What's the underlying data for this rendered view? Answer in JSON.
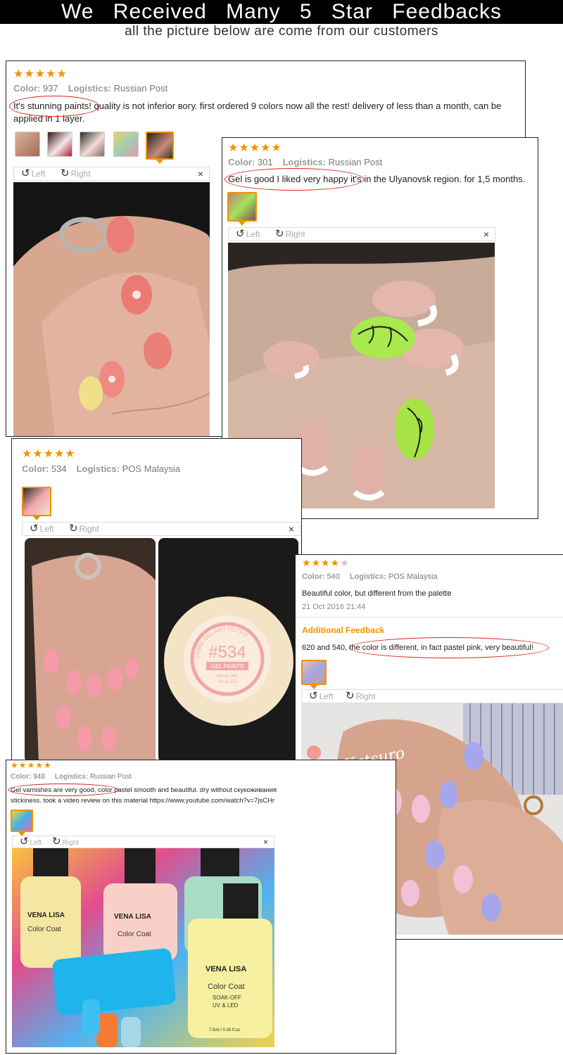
{
  "header": {
    "title": "We Received Many 5 Star Feedbacks",
    "subtitle": "all the picture below are come from our customers"
  },
  "labels": {
    "color": "Color:",
    "logistics": "Logistics:",
    "left": "Left",
    "right": "Right",
    "close": "×",
    "rotate_left": "↺",
    "rotate_right": "↻"
  },
  "colors": {
    "stars": "#f29100",
    "highlight_oval": "#dd2222",
    "additional_feedback": "#f29100"
  },
  "reviews": [
    {
      "stars": 5,
      "color": "937",
      "logistics": "Russian Post",
      "text": "It's stunning paints! quality is not inferior вогу. first ordered 9 colors now all the rest! delivery of less than a month, can be applied in 1 layer.",
      "thumbnails": 5,
      "selected_thumbnail": 5
    },
    {
      "stars": 5,
      "color": "301",
      "logistics": "Russian Post",
      "text": "Gel is good I liked very happy it's in the Ulyanovsk region. for 1,5 months.",
      "thumbnails": 1,
      "selected_thumbnail": 1
    },
    {
      "stars": 5,
      "color": "534",
      "logistics": "POS Malaysia",
      "text": "",
      "thumbnails": 1,
      "selected_thumbnail": 1,
      "jar_label": {
        "brand_ring": "CANNI GEL ART OUTFIT",
        "number": "#534",
        "name": "GEL PAINTS",
        "sub1": "SOAK-OFF",
        "sub2": "UV & LED"
      }
    },
    {
      "stars": 4,
      "color": "540",
      "logistics": "POS Malaysia",
      "text": "Beautiful color, but different from the palette",
      "date": "21 Oct 2016 21:44",
      "additional_title": "Additional Feedback",
      "additional_text": "620 and 540, the color is different, in fact pastel pink, very beautiful!",
      "watermark": "E Katsuro",
      "thumbnails": 1,
      "selected_thumbnail": 1
    },
    {
      "stars": 5,
      "color": "948",
      "logistics": "Russian Post",
      "text": "Gel varnishes are very good, color pastel smooth and beautiful. dry without скукоживания stickiness. took a video review on this material https://www.youtube.com/watch?v=7jsCHr",
      "thumbnails": 1,
      "selected_thumbnail": 1,
      "bottle_label": {
        "brand": "VENA LISA",
        "product": "Color Coat",
        "sub1": "SOAK-OFF",
        "sub2": "UV & LED",
        "volume": "7.5ml / 0.26 fl.oz"
      }
    }
  ]
}
